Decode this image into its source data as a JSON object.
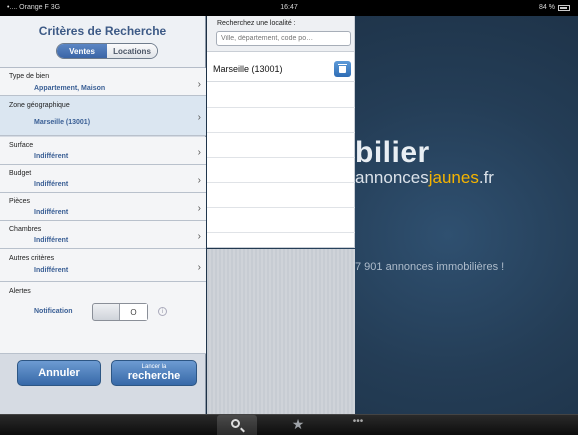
{
  "status_bar": {
    "carrier": "•.... Orange F  3G",
    "time": "16:47",
    "battery": "84 %"
  },
  "background": {
    "brand_main": "bilier",
    "brand_sub_1": "annonces",
    "brand_sub_2": "jaunes",
    "brand_sub_3": ".fr",
    "listing_count": "7 901 annonces immobilières !"
  },
  "search_panel": {
    "title": "Critères de Recherche",
    "segments": [
      {
        "label": "Ventes",
        "selected": true
      },
      {
        "label": "Locations",
        "selected": false
      }
    ],
    "rows": [
      {
        "label": "Type de bien",
        "value": "Appartement, Maison"
      },
      {
        "label": "Zone géographique",
        "value": "Marseille (13001)"
      },
      {
        "label": "Surface",
        "value": "Indifférent"
      },
      {
        "label": "Budget",
        "value": "Indifférent"
      },
      {
        "label": "Pièces",
        "value": "Indifférent"
      },
      {
        "label": "Chambres",
        "value": "Indifférent"
      },
      {
        "label": "Autres critères",
        "value": "Indifférent"
      }
    ],
    "alerts": {
      "label": "Alertes",
      "notification_label": "Notification",
      "toggle_state": "O"
    },
    "cancel_button": "Annuler",
    "search_button_small": "Lancer la",
    "search_button_big": "recherche"
  },
  "location_popover": {
    "label": "Recherchez une localité :",
    "placeholder": "Ville, département, code po…",
    "items": [
      "Marseille (13001)"
    ]
  },
  "tab_bar": {
    "tabs": [
      "search-icon",
      "star-icon",
      "more-icon"
    ]
  }
}
